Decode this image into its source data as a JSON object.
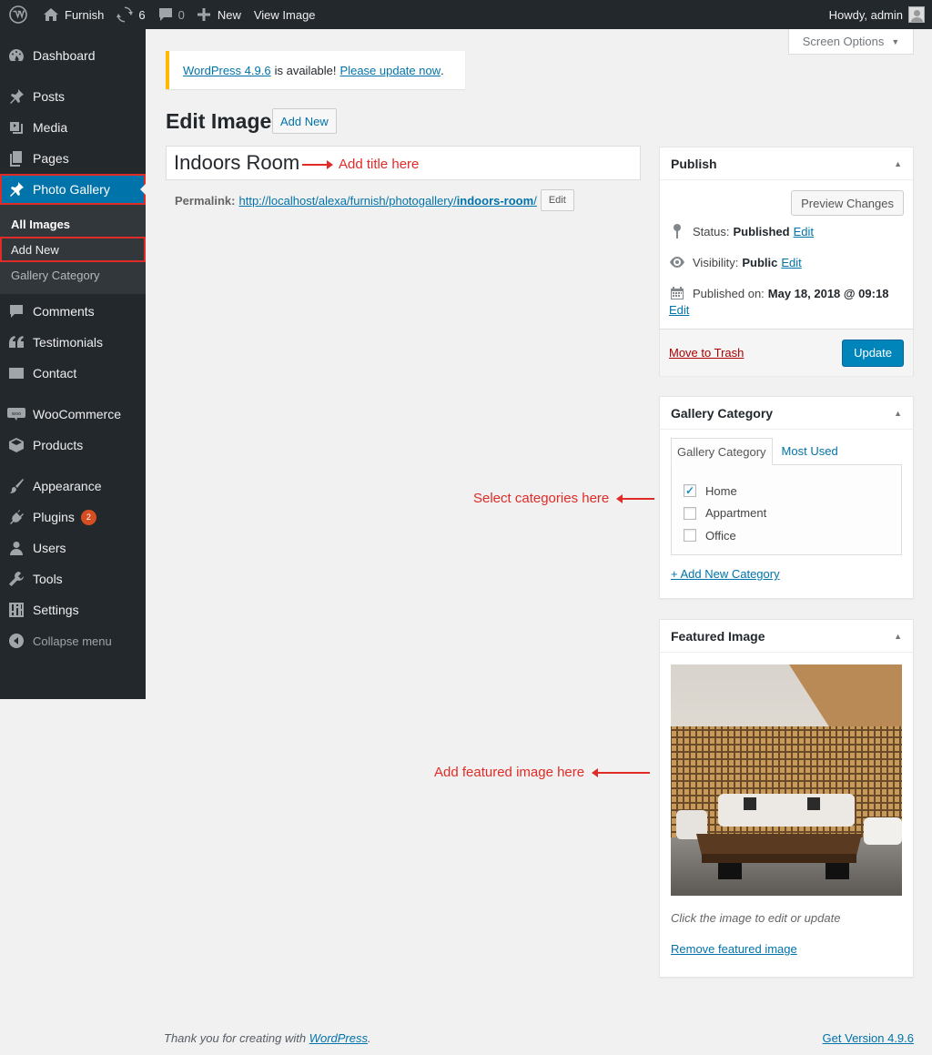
{
  "adminbar": {
    "site_name": "Furnish",
    "updates_count": "6",
    "comments_count": "0",
    "new_label": "New",
    "view_label": "View Image",
    "howdy": "Howdy, admin"
  },
  "sidebar": {
    "dashboard": "Dashboard",
    "posts": "Posts",
    "media": "Media",
    "pages": "Pages",
    "photo_gallery": "Photo Gallery",
    "sub_all_images": "All Images",
    "sub_add_new": "Add New",
    "sub_gallery_category": "Gallery Category",
    "comments": "Comments",
    "testimonials": "Testimonials",
    "contact": "Contact",
    "woocommerce": "WooCommerce",
    "products": "Products",
    "appearance": "Appearance",
    "plugins": "Plugins",
    "plugins_badge": "2",
    "users": "Users",
    "tools": "Tools",
    "settings": "Settings",
    "collapse": "Collapse menu"
  },
  "screen_options": "Screen Options",
  "notice": {
    "version_link": "WordPress 4.9.6",
    "middle": "is available!",
    "update_link": "Please update now",
    "end": "."
  },
  "page": {
    "title": "Edit Image",
    "add_new": "Add New",
    "post_title": "Indoors Room",
    "permalink_label": "Permalink:",
    "permalink_base": "http://localhost/alexa/furnish/photogallery/",
    "permalink_slug": "indoors-room",
    "permalink_end": "/",
    "permalink_edit": "Edit"
  },
  "annotations": {
    "title": "Add title here",
    "categories": "Select categories here",
    "featured": "Add featured image here"
  },
  "publish": {
    "heading": "Publish",
    "preview": "Preview Changes",
    "status_label": "Status:",
    "status_value": "Published",
    "visibility_label": "Visibility:",
    "visibility_value": "Public",
    "published_label": "Published on:",
    "published_value": "May 18, 2018 @ 09:18",
    "edit": "Edit",
    "trash": "Move to Trash",
    "update": "Update"
  },
  "gallery_category": {
    "heading": "Gallery Category",
    "tab_all": "Gallery Category",
    "tab_most_used": "Most Used",
    "items": [
      {
        "label": "Home",
        "checked": true
      },
      {
        "label": "Appartment",
        "checked": false
      },
      {
        "label": "Office",
        "checked": false
      }
    ],
    "add_new": "+ Add New Category"
  },
  "featured_image": {
    "heading": "Featured Image",
    "note": "Click the image to edit or update",
    "remove": "Remove featured image"
  },
  "footer": {
    "thanks": "Thank you for creating with",
    "wp_link": "WordPress",
    "period": ".",
    "version": "Get Version 4.9.6"
  },
  "colors": {
    "accent": "#0073aa",
    "annotation": "#e02b27",
    "admin_bg": "#23282d"
  }
}
